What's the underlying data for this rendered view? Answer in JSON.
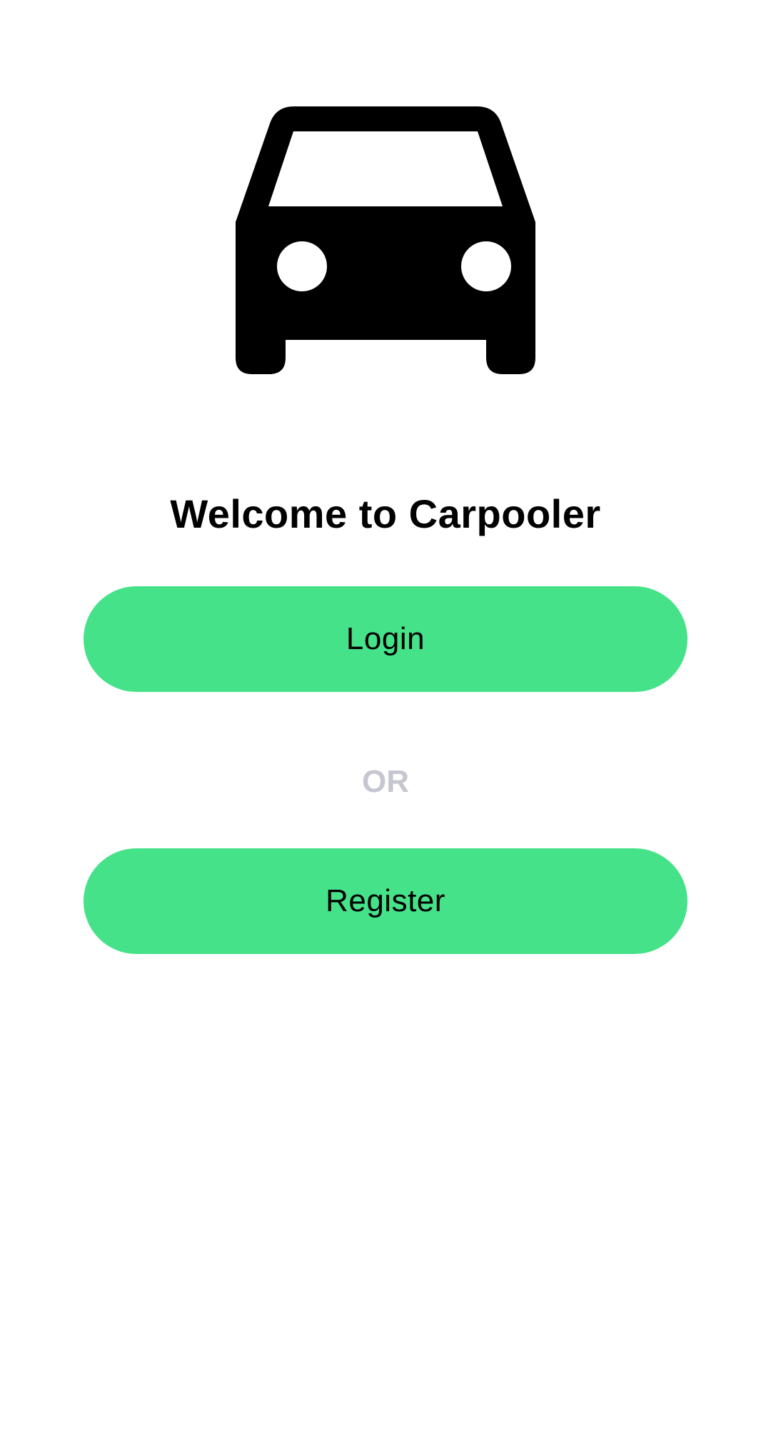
{
  "app": {
    "logo_icon": "car-front-icon",
    "welcome_title": "Welcome to Carpooler"
  },
  "actions": {
    "login_label": "Login",
    "or_label": "OR",
    "register_label": "Register"
  },
  "colors": {
    "button_background": "#45e289",
    "button_text": "#000000",
    "or_text": "#c6c6d0",
    "title_text": "#000000",
    "background": "#ffffff"
  }
}
